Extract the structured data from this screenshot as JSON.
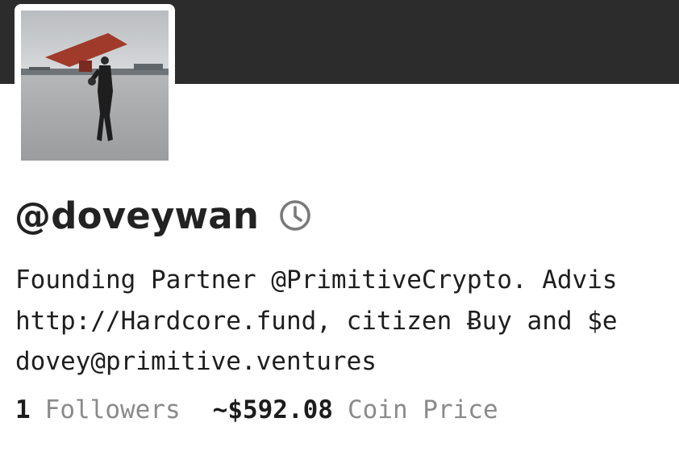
{
  "profile": {
    "handle": "@doveywan",
    "bio_lines": [
      "Founding Partner @PrimitiveCrypto. Advis",
      "http://Hardcore.fund, citizen Ƀuy and $e",
      "dovey@primitive.ventures"
    ],
    "followers": {
      "value": "1",
      "label": "Followers"
    },
    "coin_price": {
      "value": "~$592.08",
      "label": "Coin Price"
    },
    "icons": {
      "history": "clock-icon"
    }
  },
  "colors": {
    "banner": "#2c2c2c",
    "text_dark": "#222222",
    "text_muted": "#8a8a8a",
    "icon": "#7a7a7a"
  }
}
